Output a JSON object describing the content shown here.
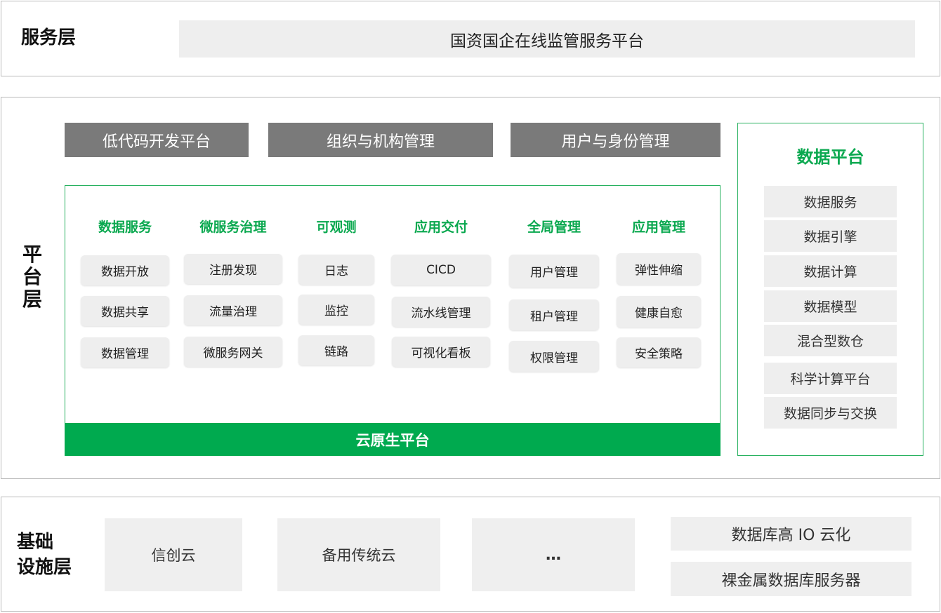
{
  "service_layer": {
    "label": "服务层",
    "platform": "国资国企在线监管服务平台"
  },
  "platform_layer": {
    "label_chars": [
      "平",
      "台",
      "层"
    ],
    "top_bars": [
      "低代码开发平台",
      "组织与机构管理",
      "用户与身份管理"
    ],
    "columns": [
      {
        "title": "数据服务",
        "items": [
          "数据开放",
          "数据共享",
          "数据管理"
        ]
      },
      {
        "title": "微服务治理",
        "items": [
          "注册发现",
          "流量治理",
          "微服务网关"
        ]
      },
      {
        "title": "可观测",
        "items": [
          "日志",
          "监控",
          "链路"
        ]
      },
      {
        "title": "应用交付",
        "items": [
          "CICD",
          "流水线管理",
          "可视化看板"
        ]
      },
      {
        "title": "全局管理",
        "items": [
          "用户管理",
          "租户管理",
          "权限管理"
        ]
      },
      {
        "title": "应用管理",
        "items": [
          "弹性伸缩",
          "健康自愈",
          "安全策略"
        ]
      }
    ],
    "cloud_native": "云原生平台",
    "data_platform": {
      "title": "数据平台",
      "items": [
        "数据服务",
        "数据引擎",
        "数据计算",
        "数据模型",
        "混合型数仓",
        "科学计算平台",
        "数据同步与交换"
      ]
    }
  },
  "infra_layer": {
    "label_lines": [
      "基础",
      "设施层"
    ],
    "boxes": [
      "信创云",
      "备用传统云",
      "…"
    ],
    "right_boxes": [
      "数据库高 IO 云化",
      "裸金属数据库服务器"
    ]
  },
  "colors": {
    "green": "#00aa4f",
    "dark_gray": "#7a7a7a",
    "light_gray": "#eeeeee",
    "border": "#b9b9b9"
  }
}
